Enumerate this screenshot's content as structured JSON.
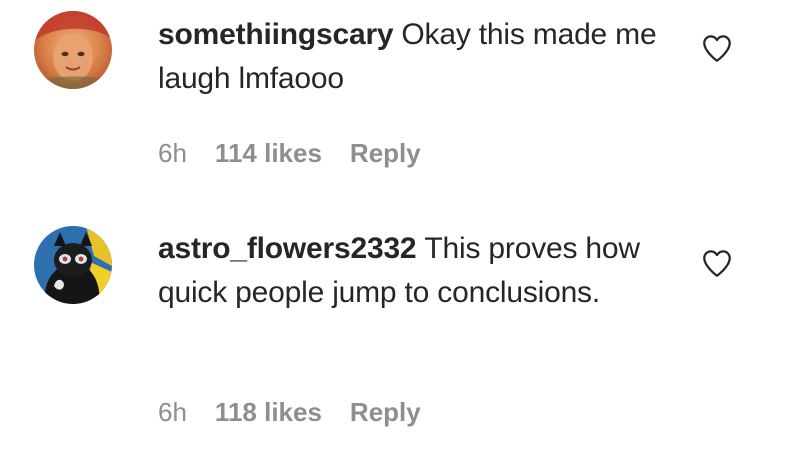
{
  "comments": [
    {
      "username": "somethiingscary",
      "text": "Okay this made me laugh lmfaooo",
      "time": "6h",
      "likes": "114 likes",
      "reply_label": "Reply",
      "avatar_icon": "user-avatar-icon",
      "like_icon": "heart-outline-icon"
    },
    {
      "username": "astro_flowers2332",
      "text": "This proves how quick people jump to conclusions.",
      "time": "6h",
      "likes": "118 likes",
      "reply_label": "Reply",
      "avatar_icon": "user-avatar-icon",
      "like_icon": "heart-outline-icon"
    }
  ]
}
